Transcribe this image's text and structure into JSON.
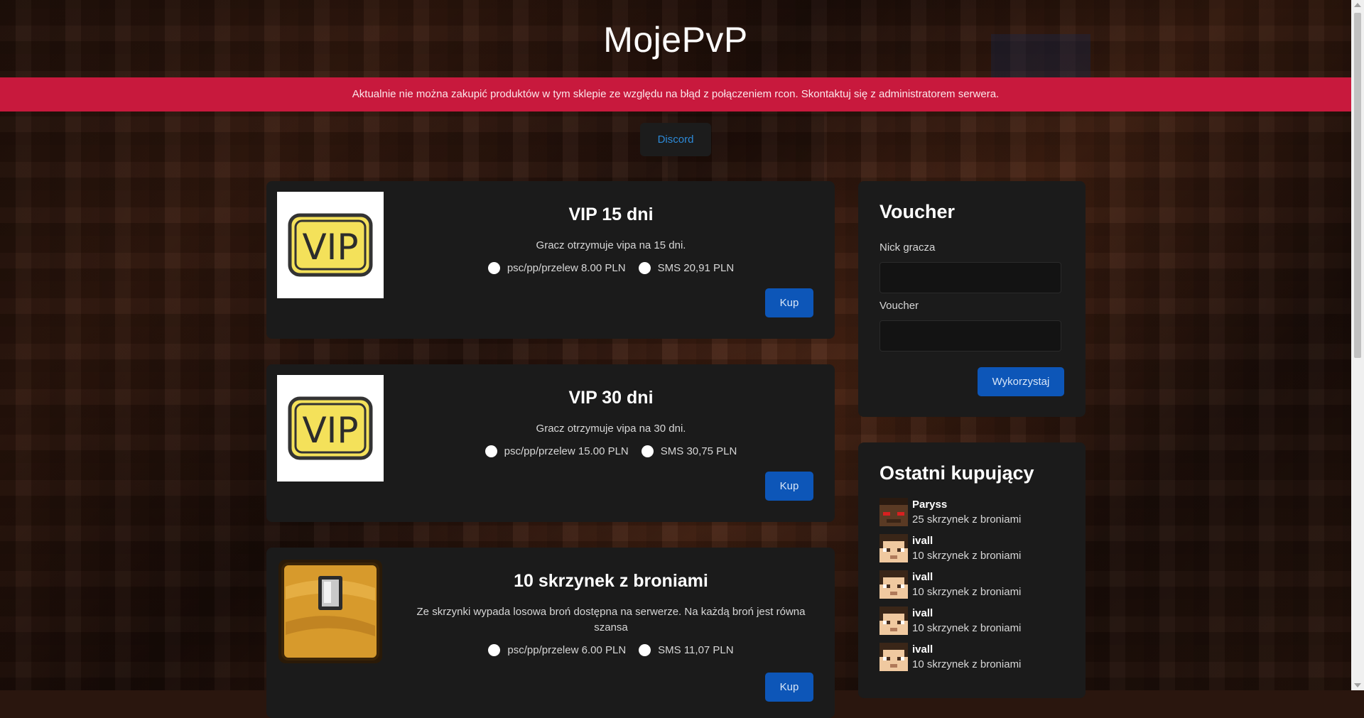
{
  "site": {
    "title": "MojePvP",
    "alert": "Aktualnie nie można zakupić produktów w tym sklepie ze względu na błąd z połączeniem rcon. Skontaktuj się z administratorem serwera.",
    "discord_label": "Discord"
  },
  "products": [
    {
      "title": "VIP 15 dni",
      "description": "Gracz otrzymuje vipa na 15 dni.",
      "price_transfer": "psc/pp/przelew 8.00 PLN",
      "price_sms": "SMS 20,91 PLN",
      "buy_label": "Kup",
      "icon": "vip-badge-icon",
      "icon_text": "VIP"
    },
    {
      "title": "VIP 30 dni",
      "description": "Gracz otrzymuje vipa na 30 dni.",
      "price_transfer": "psc/pp/przelew 15.00 PLN",
      "price_sms": "SMS 30,75 PLN",
      "buy_label": "Kup",
      "icon": "vip-badge-icon",
      "icon_text": "VIP"
    },
    {
      "title": "10 skrzynek z broniami",
      "description": "Ze skrzynki wypada losowa broń dostępna na serwerze. Na każdą broń jest równa szansa",
      "price_transfer": "psc/pp/przelew 6.00 PLN",
      "price_sms": "SMS 11,07 PLN",
      "buy_label": "Kup",
      "icon": "chest-icon"
    }
  ],
  "voucher": {
    "title": "Voucher",
    "nick_label": "Nick gracza",
    "nick_value": "",
    "voucher_label": "Voucher",
    "voucher_value": "",
    "submit_label": "Wykorzystaj"
  },
  "recent": {
    "title": "Ostatni kupujący",
    "buyers": [
      {
        "name": "Paryss",
        "item": "25 skrzynek z broniami",
        "avatar": "skin-face-icon"
      },
      {
        "name": "ivall",
        "item": "10 skrzynek z broniami",
        "avatar": "skin-face-icon"
      },
      {
        "name": "ivall",
        "item": "10 skrzynek z broniami",
        "avatar": "skin-face-icon"
      },
      {
        "name": "ivall",
        "item": "10 skrzynek z broniami",
        "avatar": "skin-face-icon"
      },
      {
        "name": "ivall",
        "item": "10 skrzynek z broniami",
        "avatar": "skin-face-icon"
      }
    ]
  },
  "colors": {
    "alert_bg": "#c8193d",
    "card_bg": "#1b1b1b",
    "button_primary": "#0d56b8",
    "link": "#2d8ad8"
  }
}
